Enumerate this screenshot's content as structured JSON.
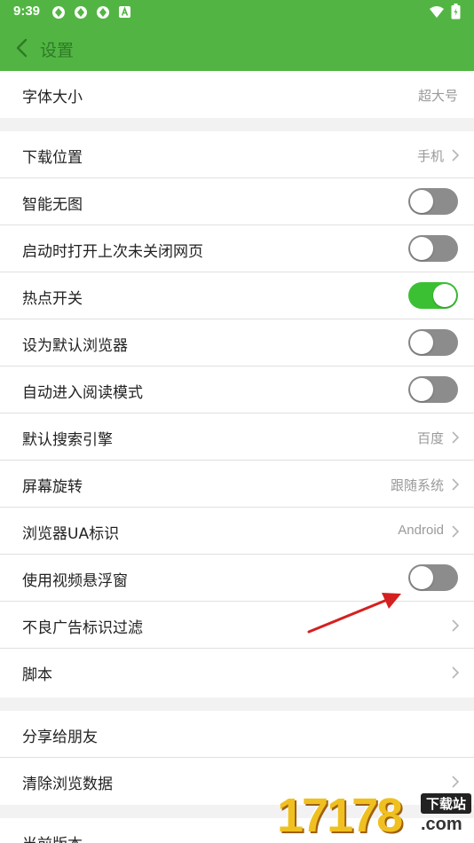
{
  "status_bar": {
    "time": "9:39",
    "icons": [
      "app-notification-icon",
      "app-notification-icon",
      "app-notification-icon",
      "a-badge-icon",
      "wifi-icon",
      "battery-charging-icon"
    ]
  },
  "header": {
    "title": "设置",
    "back_icon": "chevron-left-icon"
  },
  "colors": {
    "header_bg": "#52b543",
    "toggle_on": "#3cc033",
    "toggle_off": "#8c8c8c",
    "annotation_arrow": "#d42020"
  },
  "settings": {
    "font_size": {
      "label": "字体大小",
      "value": "超大号"
    },
    "download_location": {
      "label": "下载位置",
      "value": "手机"
    },
    "smart_no_image": {
      "label": "智能无图",
      "enabled": false
    },
    "reopen_tabs": {
      "label": "启动时打开上次未关闭网页",
      "enabled": false
    },
    "hotspot": {
      "label": "热点开关",
      "enabled": true
    },
    "default_browser": {
      "label": "设为默认浏览器",
      "enabled": false
    },
    "auto_reading_mode": {
      "label": "自动进入阅读模式",
      "enabled": false
    },
    "search_engine": {
      "label": "默认搜索引擎",
      "value": "百度"
    },
    "screen_rotation": {
      "label": "屏幕旋转",
      "value": "跟随系统"
    },
    "ua": {
      "label": "浏览器UA标识",
      "value": "Android"
    },
    "video_float": {
      "label": "使用视频悬浮窗",
      "enabled": false
    },
    "ad_filter": {
      "label": "不良广告标识过滤"
    },
    "scripts": {
      "label": "脚本"
    },
    "share": {
      "label": "分享给朋友"
    },
    "clear_data": {
      "label": "清除浏览数据"
    },
    "version": {
      "label": "当前版本"
    }
  },
  "watermark": {
    "number": "17178",
    "tag": "下载站",
    "domain": ".com"
  }
}
